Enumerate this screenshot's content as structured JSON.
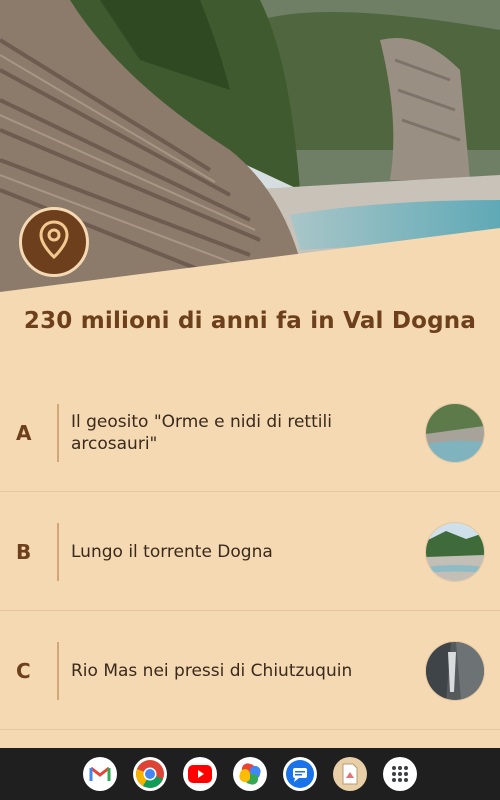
{
  "header": {
    "title": "230 milioni di anni fa in Val Dogna"
  },
  "hero": {
    "pin_icon": "map-pin-icon"
  },
  "items": [
    {
      "letter": "A",
      "label": "Il geosito \"Orme e nidi di rettili arcosauri\""
    },
    {
      "letter": "B",
      "label": "Lungo il torrente Dogna"
    },
    {
      "letter": "C",
      "label": "Rio Mas nei pressi di Chiutzuquin"
    }
  ],
  "taskbar": {
    "apps": [
      "gmail-icon",
      "chrome-icon",
      "youtube-icon",
      "photos-icon",
      "messages-icon",
      "files-icon",
      "app-drawer-icon"
    ]
  },
  "colors": {
    "accent": "#6e3f1c",
    "background": "#f4d9b3",
    "navbar": "#1f1f1f"
  }
}
